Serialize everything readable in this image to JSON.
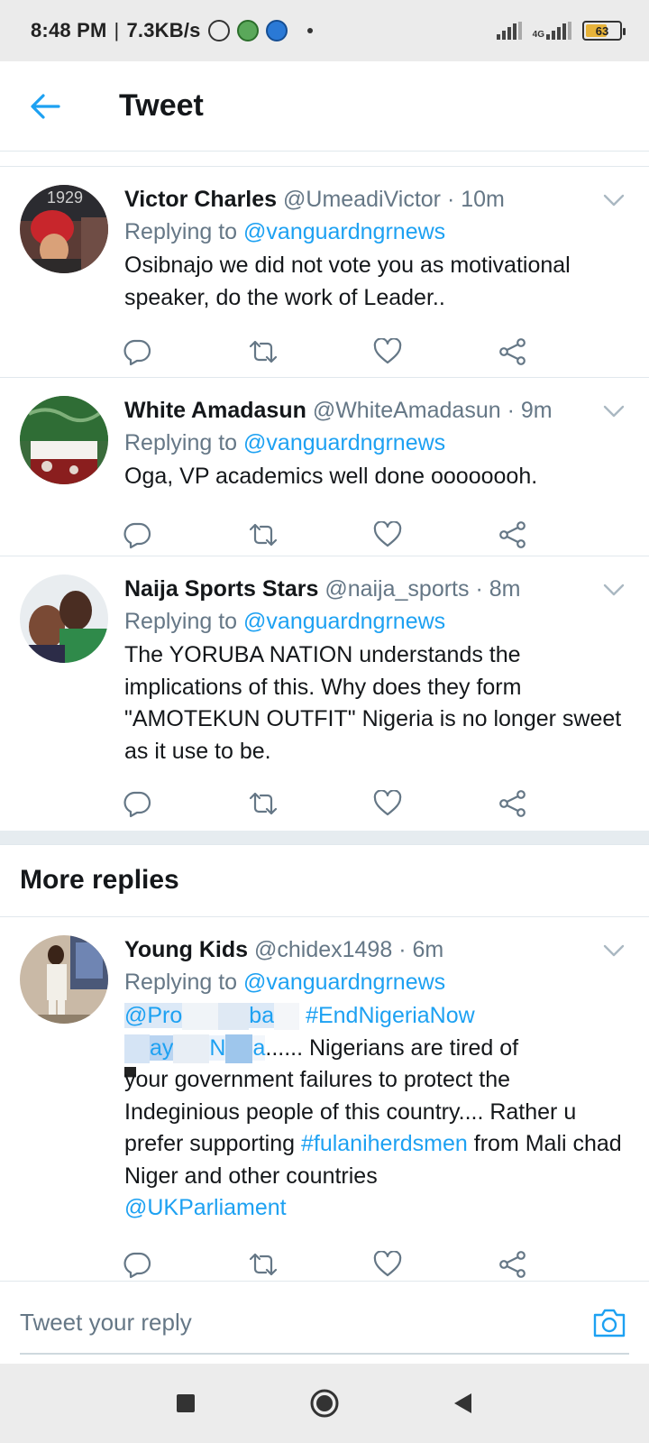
{
  "status_bar": {
    "time": "8:48 PM",
    "speed": "7.3KB/s",
    "network": "4G",
    "battery_level": "63",
    "battery_fraction": 0.63
  },
  "header": {
    "title": "Tweet",
    "back_icon": "arrow-left-icon"
  },
  "tweets": [
    {
      "name": "Victor Charles",
      "handle": "@UmeadiVictor",
      "time": "· 10m",
      "replying_prefix": "Replying to",
      "replying_handle": "@vanguardngrnews",
      "text": "Osibnajo we did not vote you as motivational speaker, do the work of Leader.."
    },
    {
      "name": "White Amadasun",
      "handle": "@WhiteAmadasun",
      "time": "· 9m",
      "replying_prefix": "Replying to",
      "replying_handle": "@vanguardngrnews",
      "text": "Oga, VP academics well done oooooooh."
    },
    {
      "name": "Naija Sports Stars",
      "handle": "@naija_sports",
      "time": "· 8m",
      "replying_prefix": "Replying to",
      "replying_handle": "@vanguardngrnews",
      "text": "The YORUBA NATION understands the implications of this. Why does they form \"AMOTEKUN OUTFIT\" Nigeria is no longer sweet as it use to be."
    }
  ],
  "more_replies": {
    "title": "More replies",
    "tweet": {
      "name": "Young Kids",
      "handle": "@chidex1498",
      "time": "· 6m",
      "replying_prefix": "Replying to",
      "replying_handle": "@vanguardngrnews",
      "line1_partial_a": "@Pro",
      "line1_partial_b": "ba",
      "hashtag1": "#EndNigeriaNow",
      "line2_partial_a": "ay",
      "line2_partial_b": "N",
      "line2_partial_c": "a",
      "line2_rest": "...... Nigerians are tired of",
      "line3_prefix": "y",
      "line3": "our government failures to protect the Indeginious people of this country.... Rather u prefer supporting",
      "hashtag2": "#fulaniherdsmen",
      "line4": "from Mali chad Niger and other countries",
      "mention_end": "@UKParliament"
    }
  },
  "reply_bar": {
    "placeholder": "Tweet your reply",
    "camera_icon": "camera-icon"
  },
  "nav": {
    "recents_icon": "square-icon",
    "home_icon": "circle-icon",
    "back_icon": "triangle-back-icon"
  },
  "colors": {
    "accent": "#1da1f2",
    "text_secondary": "#657786",
    "text_primary": "#14171a"
  }
}
